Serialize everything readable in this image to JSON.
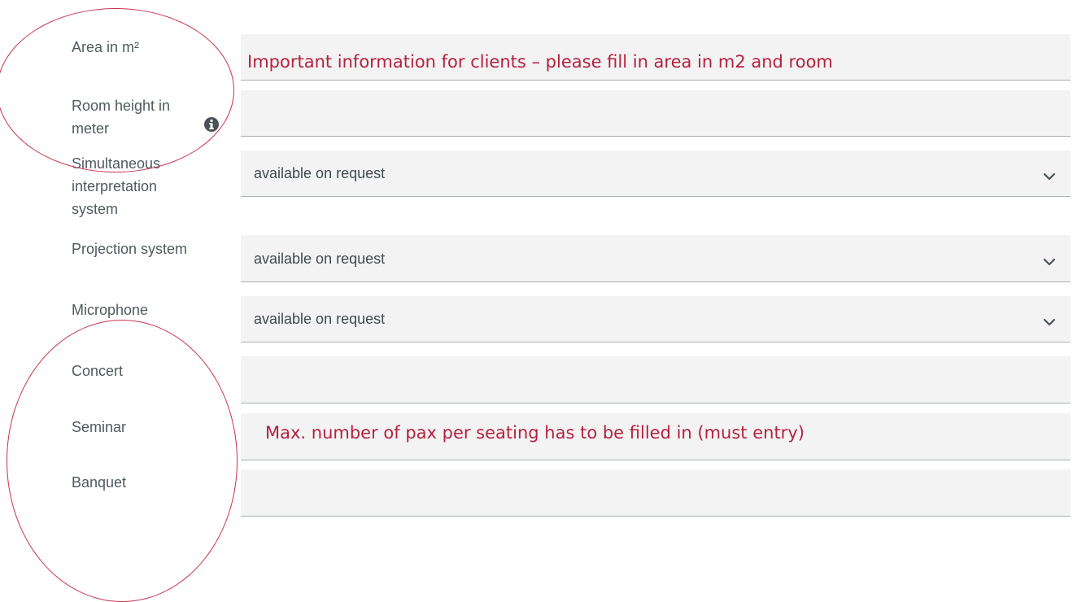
{
  "labels": {
    "area": "Area in m²",
    "room_height": "Room height in meter",
    "simultaneous": "Simultaneous interpretation system",
    "projection": "Projection system",
    "microphone": "Microphone",
    "concert": "Concert",
    "seminar": "Seminar",
    "banquet": "Banquet"
  },
  "fields": {
    "area_value": "",
    "room_height_value": "",
    "simultaneous_selected": "available on request",
    "projection_selected": "available on request",
    "microphone_selected": "available on request",
    "concert_value": "",
    "seminar_value": "",
    "banquet_value": ""
  },
  "annotations": {
    "top_note": "Important information for clients – please fill in area in m2 and room",
    "seating_note": "Max. number of pax per seating has to be filled in (must entry)"
  },
  "icons": {
    "info": "info-icon",
    "dropdown": "chevron-down-icon"
  },
  "colors": {
    "annotation": "#b5213f",
    "field_bg": "#f3f3f3",
    "label": "#4f5a5f"
  }
}
